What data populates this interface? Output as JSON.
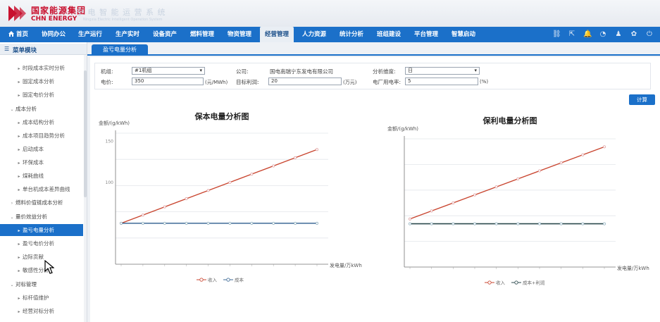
{
  "header": {
    "logo_cn": "国家能源集团",
    "logo_en": "CHN ENERGY",
    "subtitle": "宁 电 智 能 运 营 系 统",
    "subtitle_small": "Ningxia Electric Intelligent Operation System"
  },
  "nav": {
    "items": [
      {
        "label": "首页"
      },
      {
        "label": "协同办公"
      },
      {
        "label": "生产运行"
      },
      {
        "label": "生产实时"
      },
      {
        "label": "设备资产"
      },
      {
        "label": "燃料管理"
      },
      {
        "label": "物资管理"
      },
      {
        "label": "经营管理"
      },
      {
        "label": "人力资源"
      },
      {
        "label": "统计分析"
      },
      {
        "label": "班组建设"
      },
      {
        "label": "平台管理"
      },
      {
        "label": "智慧启动"
      }
    ],
    "active_index": 7,
    "tools": [
      {
        "icon": "org-chart-icon",
        "glyph": "⛓"
      },
      {
        "icon": "export-icon",
        "glyph": "⇱"
      },
      {
        "icon": "bell-icon",
        "glyph": "🔔"
      },
      {
        "icon": "gauge-icon",
        "glyph": "◔"
      },
      {
        "icon": "user-icon",
        "glyph": "♟"
      },
      {
        "icon": "settings-icon",
        "glyph": "✿"
      },
      {
        "icon": "power-icon",
        "glyph": "⏻"
      }
    ]
  },
  "sidebar": {
    "title": "菜单模块",
    "items": [
      {
        "label": "时段成本实时分析",
        "level": 2
      },
      {
        "label": "固定成本分析",
        "level": 2
      },
      {
        "label": "固定电价分析",
        "level": 2
      },
      {
        "label": "成本分析",
        "level": 1,
        "expanded": true
      },
      {
        "label": "成本结构分析",
        "level": 2
      },
      {
        "label": "成本项目趋势分析",
        "level": 2
      },
      {
        "label": "启动成本",
        "level": 2
      },
      {
        "label": "环保成本",
        "level": 2
      },
      {
        "label": "煤耗曲线",
        "level": 2
      },
      {
        "label": "单台机成本差异曲线",
        "level": 2
      },
      {
        "label": "燃料价值链成本分析",
        "level": 1,
        "expanded": false
      },
      {
        "label": "量价效益分析",
        "level": 1,
        "expanded": true
      },
      {
        "label": "盈亏电量分析",
        "level": 2,
        "active": true
      },
      {
        "label": "盈亏电价分析",
        "level": 2
      },
      {
        "label": "边际贡献",
        "level": 2
      },
      {
        "label": "敏感性分析",
        "level": 2
      },
      {
        "label": "对标管理",
        "level": 1,
        "expanded": true
      },
      {
        "label": "标杆值维护",
        "level": 2
      },
      {
        "label": "经营对标分析",
        "level": 2
      }
    ]
  },
  "tab": {
    "label": "盈亏电量分析"
  },
  "form": {
    "unit_label": "机组:",
    "unit_value": "#1机组",
    "company_label": "公司:",
    "company_value": "国电南瑞宁东发电有限公司",
    "dimension_label": "分析维度:",
    "dimension_value": "日",
    "price_label": "电价:",
    "price_value": "350",
    "price_unit": "(元/MWh)",
    "target_label": "目标利润:",
    "target_value": "20",
    "target_unit": "(万元)",
    "plant_rate_label": "电厂用电率:",
    "plant_rate_value": "5",
    "plant_rate_unit": "(%)",
    "calc_button": "计算"
  },
  "charts": {
    "left": {
      "title": "保本电量分析图",
      "ylabel": "金额/(g/kWh)",
      "xlabel": "发电量/万kWh"
    },
    "right": {
      "title": "保利电量分析图",
      "ylabel": "金额/(g/kWh)",
      "xlabel": "发电量/万kWh"
    }
  },
  "chart_data": [
    {
      "type": "line",
      "title": "保本电量分析图",
      "ylabel": "金额/(g/kWh)",
      "xlabel": "发电量/万kWh",
      "y_ticks": [
        "150",
        "100"
      ],
      "x": [
        0,
        1,
        2,
        3,
        4,
        5,
        6,
        7,
        8,
        9
      ],
      "series": [
        {
          "name": "收入",
          "color": "#c9452f",
          "values": [
            50,
            60,
            70,
            80,
            90,
            100,
            110,
            120,
            130,
            140
          ]
        },
        {
          "name": "成本",
          "color": "#3d6a96",
          "values": [
            50,
            50,
            50,
            50,
            50,
            50,
            50,
            50,
            50,
            50
          ]
        }
      ],
      "ylim": [
        0,
        160
      ],
      "grid": true,
      "legend": "bottom"
    },
    {
      "type": "line",
      "title": "保利电量分析图",
      "ylabel": "金额/(g/kWh)",
      "xlabel": "发电量/万kWh",
      "y_ticks": [],
      "x": [
        0,
        1,
        2,
        3,
        4,
        5,
        6,
        7,
        8,
        9
      ],
      "series": [
        {
          "name": "收入",
          "color": "#c9452f",
          "values": [
            60,
            70,
            80,
            90,
            100,
            110,
            120,
            130,
            140,
            150
          ]
        },
        {
          "name": "成本+利润",
          "color": "#2c4a4e",
          "values": [
            54,
            54,
            54,
            54,
            54,
            54,
            54,
            54,
            54,
            54
          ]
        }
      ],
      "ylim": [
        0,
        160
      ],
      "grid": true,
      "legend": "bottom"
    }
  ]
}
